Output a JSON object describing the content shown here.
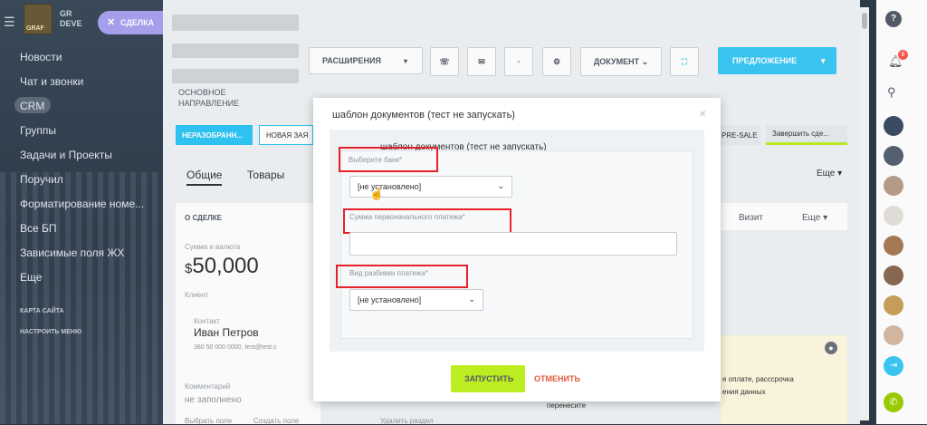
{
  "sidebar": {
    "brand_line1": "GR",
    "brand_line2": "DEVE",
    "logo_text": "GRAF",
    "deal_chip_label": "СДЕЛКА",
    "items": [
      {
        "label": "Новости"
      },
      {
        "label": "Чат и звонки"
      },
      {
        "label": "CRM"
      },
      {
        "label": "Группы"
      },
      {
        "label": "Задачи и Проекты"
      },
      {
        "label": "Поручил"
      },
      {
        "label": "Форматирование номе..."
      },
      {
        "label": "Все БП"
      },
      {
        "label": "Зависимые поля ЖХ"
      },
      {
        "label": "Еще"
      }
    ],
    "small_links": [
      "КАРТА САЙТА",
      "НАСТРОИТЬ МЕНЮ"
    ]
  },
  "header": {
    "direction_label": "ОСНОВНОЕ НАПРАВЛЕНИЕ",
    "extensions_label": "РАСШИРЕНИЯ",
    "document_label": "ДОКУМЕНТ",
    "offer_label": "ПРЕДЛОЖЕНИЕ"
  },
  "stages": [
    {
      "label": "НЕРАЗОБРАНН..."
    },
    {
      "label": "НОВАЯ ЗАЯ"
    },
    {
      "label": "PRE-SALE"
    },
    {
      "label": "Завершить сде..."
    }
  ],
  "tabs": {
    "general": "Общие",
    "products": "Товары",
    "more": "Еще"
  },
  "deal": {
    "section_title": "О СДЕЛКЕ",
    "amount_label": "Сумма и валюта",
    "amount_currency": "$",
    "amount_value": "50,000",
    "client_label": "Клиент",
    "contact_label": "Контакт",
    "contact_name": "Иван Петров",
    "contact_details": "380 50 000 0000, test@test.c",
    "comment_label": "Комментарий",
    "comment_value": "не заполнено",
    "footer_left": "Выбрать поле",
    "footer_mid": "Создать поле",
    "footer_right": "Удалить раздел"
  },
  "right_panel": {
    "visit_label": "Визит",
    "more_label": "Еще",
    "activity_line1": "е оплате, расссрочка",
    "activity_line2": "ения данных",
    "activity_line3": "перенесите"
  },
  "rail": {
    "help_icon": "?",
    "notif_count": "8"
  },
  "modal": {
    "title": "шаблон документов (тест не запускать)",
    "form_caption": "шаблон документов (тест не запускать)",
    "bank_label": "Выберите банк*",
    "bank_value": "[не установлено]",
    "initial_payment_label": "Сумма первоначального платежа*",
    "initial_payment_value": "",
    "split_label": "Вид разбивки платежа*",
    "split_value": "[не установлено]",
    "run_label": "ЗАПУСТИТЬ",
    "cancel_label": "ОТМЕНИТЬ"
  },
  "colors": {
    "accent_blue": "#3bc8f5",
    "run_green": "#bbed21",
    "highlight_red": "#e8202a",
    "stage_blue": "#2fc6f6"
  }
}
